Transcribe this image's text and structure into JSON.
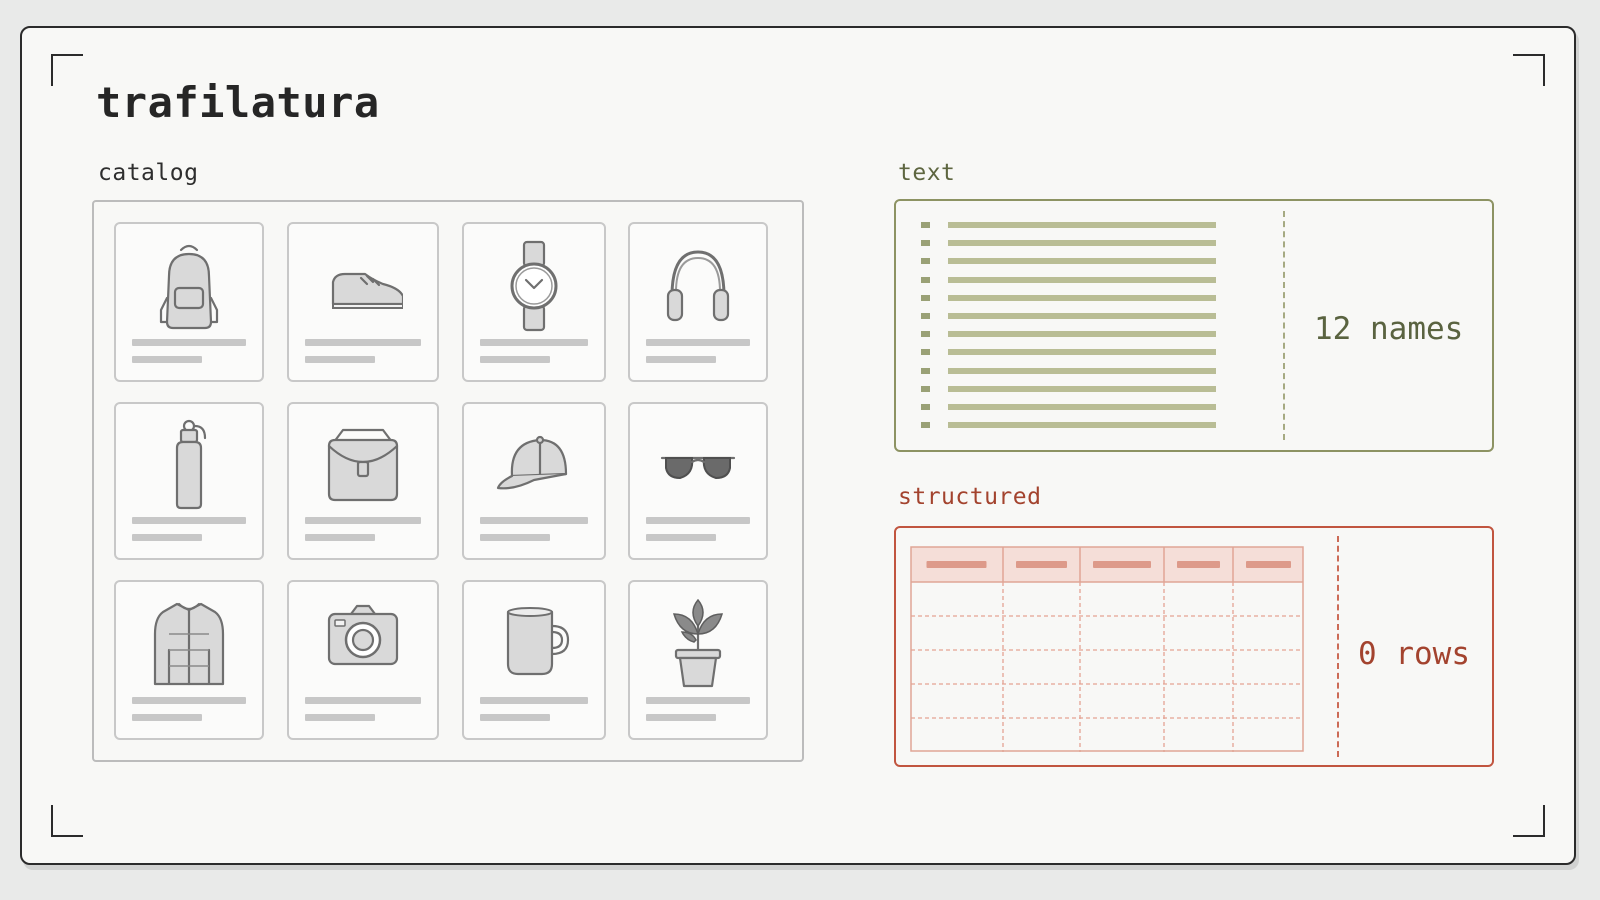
{
  "title": "trafilatura",
  "catalog": {
    "label": "catalog",
    "products": [
      {
        "icon": "backpack-icon"
      },
      {
        "icon": "sneaker-icon"
      },
      {
        "icon": "watch-icon"
      },
      {
        "icon": "headphones-icon"
      },
      {
        "icon": "water-bottle-icon"
      },
      {
        "icon": "messenger-bag-icon"
      },
      {
        "icon": "cap-icon"
      },
      {
        "icon": "sunglasses-icon"
      },
      {
        "icon": "jacket-icon"
      },
      {
        "icon": "camera-icon"
      },
      {
        "icon": "mug-icon"
      },
      {
        "icon": "potted-plant-icon"
      }
    ]
  },
  "text_output": {
    "label": "text",
    "count_label": "12 names",
    "line_count": 12,
    "color": "#8d9363"
  },
  "structured_output": {
    "label": "structured",
    "count_label": "0 rows",
    "column_count": 5,
    "empty_row_count": 5,
    "color": "#c1553f"
  }
}
